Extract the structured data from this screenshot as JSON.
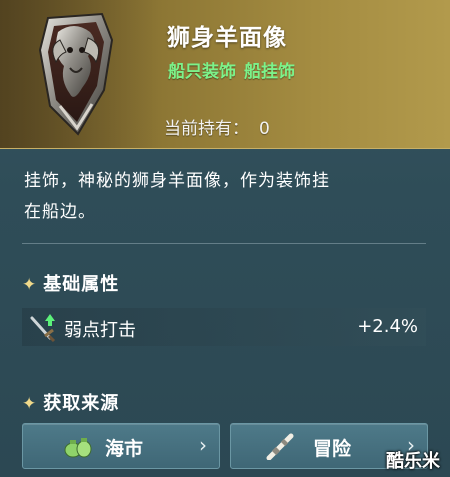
{
  "item": {
    "title": "狮身羊面像",
    "tags": [
      "船只装饰",
      "船挂饰"
    ],
    "owned_label": "当前持有：",
    "owned_count": "0",
    "icon": "ram-head-shield-icon"
  },
  "description": {
    "line1": "挂饰，神秘的狮身羊面像，作为装饰挂",
    "line2": "在船边。"
  },
  "attributes": {
    "star": "✦",
    "title": "基础属性",
    "stats": [
      {
        "name": "弱点打击",
        "value": "+2.4%",
        "icon": "sword-up-arrow-icon"
      }
    ]
  },
  "sources": {
    "star": "✦",
    "title": "获取来源",
    "buttons": [
      {
        "label": "海市",
        "icon": "money-bag-icon",
        "chevron": "›"
      },
      {
        "label": "冒险",
        "icon": "spyglass-icon",
        "chevron": "›"
      }
    ]
  },
  "watermark": "酷乐米",
  "colors": {
    "header_gold": "#a48c41",
    "tag_green": "#7cf28a",
    "panel_teal": "#2f4d58",
    "button_teal": "#4e7a89"
  }
}
